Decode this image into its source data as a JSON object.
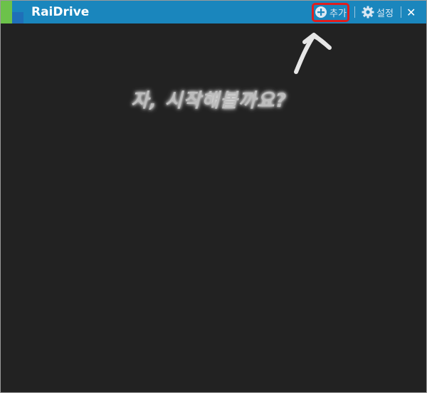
{
  "window": {
    "title": "RaiDrive"
  },
  "toolbar": {
    "add_label": "추가",
    "add_icon": "plus-circle-icon",
    "settings_label": "설정",
    "settings_icon": "gear-icon",
    "close_glyph": "✕",
    "close_icon": "close-icon"
  },
  "annotation": {
    "text": "자, 시작해볼까요?"
  },
  "colors": {
    "titlebar": "#1a86bd",
    "background": "#222222",
    "logo_green": "#6cc24a",
    "logo_blue": "#1f6fb8",
    "highlight": "#e01e1e"
  }
}
